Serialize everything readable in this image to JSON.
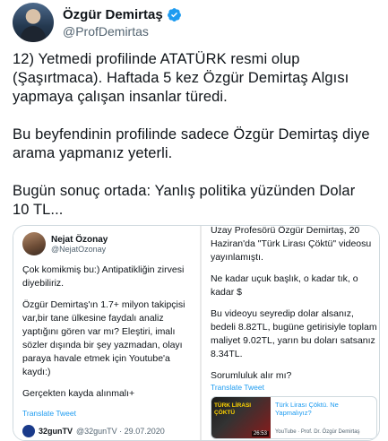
{
  "author": {
    "display_name": "Özgür Demirtaş",
    "handle": "@ProfDemirtas"
  },
  "tweet": {
    "paragraphs": [
      "12) Yetmedi profilinde ATATÜRK resmi olup (Şaşırtmaca). Haftada 5 kez Özgür Demirtaş Algısı yapmaya çalışan insanlar türedi.",
      "Bu beyfendinin profilinde sadece Özgür Demirtaş diye arama yapmanız yeterli.",
      "Bugün sonuç ortada: Yanlış politika yüzünden Dolar 10 TL..."
    ]
  },
  "media": {
    "left": {
      "name": "Nejat Özonay",
      "handle": "@NejatOzonay",
      "paragraphs": [
        "Çok komikmiş bu:) Antipatikliğin zirvesi diyebiliriz.",
        "Özgür Demirtaş'ın 1.7+ milyon takipçisi var,bir tane ülkesine faydalı analiz yaptığını gören var mı? Eleştiri, imalı sözler dışında bir şey yazmadan, olayı paraya havale etmek için Youtube'a kaydı:)",
        "Gerçekten kayda alınmalı+"
      ],
      "translate": "Translate Tweet",
      "footer_name": "32gunTV",
      "footer_handle": "@32gunTV · 29.07.2020"
    },
    "right": {
      "paragraphs": [
        "Uzay Profesörü Özgür Demirtaş, 20 Haziran'da \"Türk Lirası Çöktü\" videosu yayınlamıştı.",
        "Ne kadar uçuk başlık, o kadar tık, o kadar $",
        "Bu videoyu seyredip dolar alsanız, bedeli 8.82TL, bugüne getirisiyle toplam maliyet 9.02TL, yarın bu doları satsanız 8.34TL.",
        "Sorumluluk alır mı?"
      ],
      "translate": "Translate Tweet",
      "youtube": {
        "thumb_label": "TÜRK LİRASI ÇÖKTÜ",
        "duration": "26:53",
        "title": "Türk Lirası Çöktü. Ne Yapmalıyız?",
        "source": "YouTube · Prof. Dr. Özgür Demirtaş"
      }
    }
  },
  "colors": {
    "link": "#1d9bf0",
    "verified": "#1d9bf0",
    "text": "#0f1419",
    "muted": "#536471"
  }
}
